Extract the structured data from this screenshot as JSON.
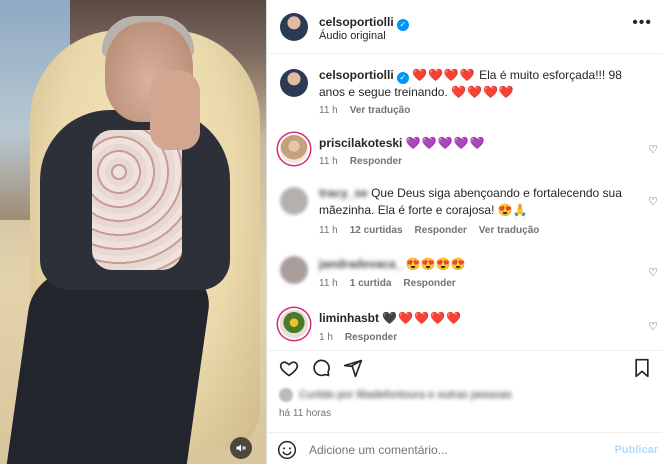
{
  "media": {
    "mute_icon": "speaker-muted-icon"
  },
  "header": {
    "username": "celsoportiolli",
    "subtitle": "Áudio original",
    "verified_icon": "verified-badge-icon",
    "more_icon": "more-dots-icon"
  },
  "caption": {
    "username": "celsoportiolli",
    "hearts_before": "❤️❤️❤️❤️",
    "text": "Ela é muito esforçada!!! 98 anos e segue treinando.",
    "hearts_after": "❤️❤️❤️❤️",
    "time": "11 h",
    "translate": "Ver tradução"
  },
  "comments": [
    {
      "username": "priscilakoteski",
      "text": "💜💜💜💜💜",
      "time": "11 h",
      "reply": "Responder"
    },
    {
      "username": "tracy_se",
      "text": "Que Deus siga abençoando e fortalecendo sua mãezinha. Ela é forte e corajosa! 😍🙏",
      "time": "11 h",
      "likes": "12 curtidas",
      "reply": "Responder",
      "translate": "Ver tradução"
    },
    {
      "username": "jandradevaca_",
      "text": "😍😍😍😍",
      "time": "11 h",
      "likes": "1 curtida",
      "reply": "Responder"
    },
    {
      "username": "liminhasbt",
      "text": "🖤❤️❤️❤️❤️",
      "time": "1 h",
      "reply": "Responder"
    }
  ],
  "actions": {
    "like_icon": "heart-outline-icon",
    "comment_icon": "comment-bubble-icon",
    "share_icon": "paper-plane-icon",
    "save_icon": "bookmark-icon"
  },
  "likes_line": {
    "text": "Curtido por liliadefontoura e outras pessoas"
  },
  "time_ago": "há 11 horas",
  "comment_bar": {
    "emoji_icon": "smiley-icon",
    "placeholder": "Adicione um comentário...",
    "post_label": "Publicar"
  }
}
